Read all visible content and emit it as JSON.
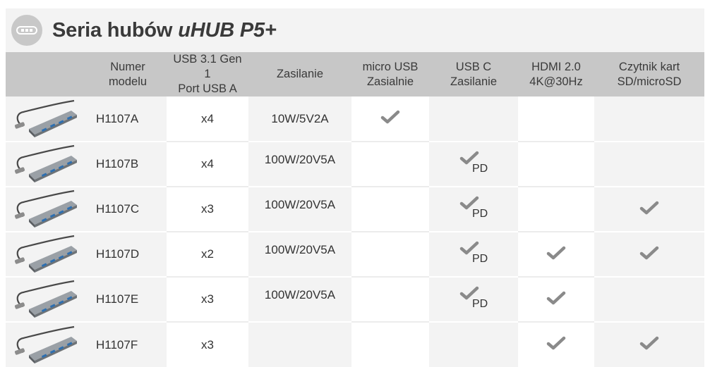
{
  "title": {
    "prefix": "Seria hubów",
    "model": "uHUB P5+"
  },
  "headers": [
    "",
    "Numer\nmodelu",
    "USB 3.1 Gen 1\nPort USB A",
    "Zasilanie",
    "micro USB\nZasialnie",
    "USB C\nZasilanie",
    "HDMI 2.0\n4K@30Hz",
    "Czytnik kart\nSD/microSD"
  ],
  "pd_label": "PD",
  "rows": [
    {
      "model": "H1107A",
      "usb_a": "x4",
      "power": "10W/5V2A",
      "micro_usb": true,
      "usb_c": false,
      "hdmi": false,
      "card_reader": false
    },
    {
      "model": "H1107B",
      "usb_a": "x4",
      "power": "100W/20V5A",
      "micro_usb": false,
      "usb_c": true,
      "hdmi": false,
      "card_reader": false
    },
    {
      "model": "H1107C",
      "usb_a": "x3",
      "power": "100W/20V5A",
      "micro_usb": false,
      "usb_c": true,
      "hdmi": false,
      "card_reader": true
    },
    {
      "model": "H1107D",
      "usb_a": "x2",
      "power": "100W/20V5A",
      "micro_usb": false,
      "usb_c": true,
      "hdmi": true,
      "card_reader": true
    },
    {
      "model": "H1107E",
      "usb_a": "x3",
      "power": "100W/20V5A",
      "micro_usb": false,
      "usb_c": true,
      "hdmi": true,
      "card_reader": false
    },
    {
      "model": "H1107F",
      "usb_a": "x3",
      "power": "",
      "micro_usb": false,
      "usb_c": false,
      "hdmi": true,
      "card_reader": true
    }
  ],
  "colors": {
    "header_bg": "#c7c7c7",
    "check": "#8a8a8a",
    "panel": "#f3f3f3"
  }
}
